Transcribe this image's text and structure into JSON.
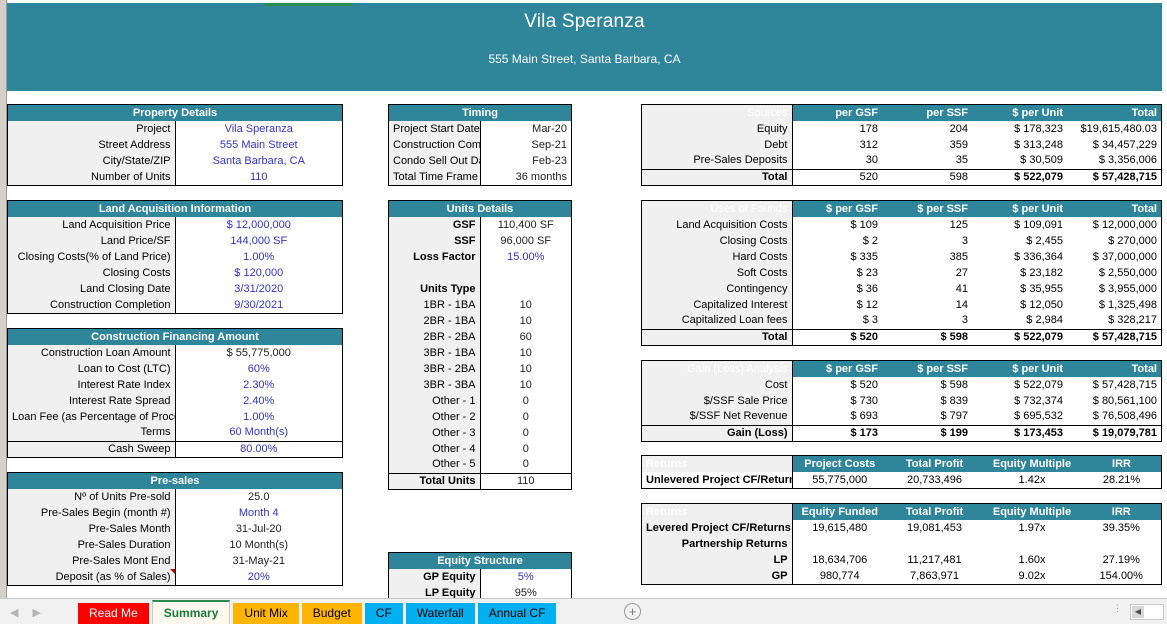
{
  "banner": {
    "title": "Vila Speranza",
    "subtitle": "555 Main Street, Santa Barbara, CA"
  },
  "property_details": {
    "header": "Property Details",
    "rows": [
      {
        "label": "Project",
        "value": "Vila Speranza",
        "style": "blue"
      },
      {
        "label": "Street Address",
        "value": "555 Main Street",
        "style": "blue"
      },
      {
        "label": "City/State/ZIP",
        "value": "Santa Barbara, CA",
        "style": "blue"
      },
      {
        "label": "Number of Units",
        "value": "110",
        "style": "blue"
      }
    ]
  },
  "land_acquisition": {
    "header": "Land Acquisition Information",
    "rows": [
      {
        "label": "Land Acquisition  Price",
        "value": "$ 12,000,000",
        "style": "blue"
      },
      {
        "label": "Land Price/SF",
        "value": "144,000 SF",
        "style": "blue"
      },
      {
        "label": "Closing Costs(% of Land Price)",
        "value": "1.00%",
        "style": "blue"
      },
      {
        "label": "Closing Costs",
        "value": "$ 120,000",
        "style": "blue"
      },
      {
        "label": "Land Closing Date",
        "value": "3/31/2020",
        "style": "blue"
      },
      {
        "label": "Construction Completion",
        "value": "9/30/2021",
        "style": "blue"
      }
    ]
  },
  "construction_financing": {
    "header": "Construction Financing Amount",
    "rows": [
      {
        "label": "Construction Loan Amount",
        "value": "$ 55,775,000",
        "style": "dark"
      },
      {
        "label": "Loan to Cost (LTC)",
        "value": "60%",
        "style": "blue"
      },
      {
        "label": "Interest Rate Index",
        "value": "2.30%",
        "style": "blue"
      },
      {
        "label": "Interest Rate Spread",
        "value": "2.40%",
        "style": "blue"
      },
      {
        "label": "Loan Fee (as Percentage of Proceeds)",
        "value": "1.00%",
        "style": "blue"
      },
      {
        "label": "Terms",
        "value": "60 Month(s)",
        "style": "blue"
      },
      {
        "label": "Cash Sweep",
        "value": "80.00%",
        "style": "blue",
        "divider": true
      }
    ]
  },
  "presales": {
    "header": "Pre-sales",
    "rows": [
      {
        "label": "Nº of Units Pre-sold",
        "value": "25.0",
        "style": "dark"
      },
      {
        "label": "Pre-Sales Begin (month #)",
        "value": "Month 4",
        "style": "blue"
      },
      {
        "label": "Pre-Sales Month",
        "value": "31-Jul-20",
        "style": "dark"
      },
      {
        "label": "Pre-Sales Duration",
        "value": "10 Month(s)",
        "style": "dark"
      },
      {
        "label": "Pre-Sales Mont End",
        "value": "31-May-21",
        "style": "dark"
      },
      {
        "label": "Deposit (as % of Sales)",
        "value": "20%",
        "style": "blue",
        "comment": true
      }
    ]
  },
  "timing": {
    "header": "Timing",
    "rows": [
      {
        "label": "Project Start Date",
        "value": "Mar-20"
      },
      {
        "label": "Construction Completion",
        "value": "Sep-21"
      },
      {
        "label": "Condo Sell Out Date",
        "value": "Feb-23"
      },
      {
        "label": "Total Time Frame",
        "value": "36 months"
      }
    ]
  },
  "units_details": {
    "header": "Units Details",
    "top_rows": [
      {
        "label": "GSF",
        "value": "110,400 SF",
        "style": "dark"
      },
      {
        "label": "SSF",
        "value": "96,000 SF",
        "style": "dark"
      },
      {
        "label": "Loss Factor",
        "value": "15.00%",
        "style": "blue"
      }
    ],
    "units_type_label": "Units Type",
    "unit_rows": [
      {
        "label": "1BR - 1BA",
        "value": "10"
      },
      {
        "label": "2BR - 1BA",
        "value": "10"
      },
      {
        "label": "2BR - 2BA",
        "value": "60"
      },
      {
        "label": "3BR - 1BA",
        "value": "10"
      },
      {
        "label": "3BR - 2BA",
        "value": "10"
      },
      {
        "label": "3BR - 3BA",
        "value": "10"
      },
      {
        "label": "Other - 1",
        "value": "0"
      },
      {
        "label": "Other - 2",
        "value": "0"
      },
      {
        "label": "Other - 3",
        "value": "0"
      },
      {
        "label": "Other - 4",
        "value": "0"
      },
      {
        "label": "Other - 5",
        "value": "0"
      }
    ],
    "total": {
      "label": "Total Units",
      "value": "110"
    }
  },
  "equity_structure": {
    "header": "Equity Structure",
    "rows": [
      {
        "label": "GP Equity",
        "value": "5%",
        "style": "blue"
      },
      {
        "label": "LP Equity",
        "value": "95%",
        "style": "dark"
      }
    ]
  },
  "sources": {
    "columns": [
      "Sources",
      "per GSF",
      "per SSF",
      "$ per Unit",
      "Total"
    ],
    "rows": [
      [
        "Equity",
        "178",
        "204",
        "$ 178,323",
        "$19,615,480.03"
      ],
      [
        "Debt",
        "312",
        "359",
        "$ 313,248",
        "$ 34,457,229"
      ],
      [
        "Pre-Sales Deposits",
        "30",
        "35",
        "$ 30,509",
        "$ 3,356,006"
      ]
    ],
    "total": [
      "Total",
      "520",
      "598",
      "$ 522,079",
      "$ 57,428,715"
    ]
  },
  "uses": {
    "columns": [
      "Uses of Founds",
      "$ per GSF",
      "$ per SSF",
      "$ per Unit",
      "Total"
    ],
    "rows": [
      [
        "Land Acquisition Costs",
        "$ 109",
        "125",
        "$ 109,091",
        "$ 12,000,000"
      ],
      [
        "Closing Costs",
        "$ 2",
        "3",
        "$ 2,455",
        "$ 270,000"
      ],
      [
        "Hard Costs",
        "$ 335",
        "385",
        "$ 336,364",
        "$ 37,000,000"
      ],
      [
        "Soft Costs",
        "$ 23",
        "27",
        "$ 23,182",
        "$ 2,550,000"
      ],
      [
        "Contingency",
        "$ 36",
        "41",
        "$ 35,955",
        "$ 3,955,000"
      ],
      [
        "Capitalized Interest",
        "$ 12",
        "14",
        "$ 12,050",
        "$ 1,325,498"
      ],
      [
        "Capitalized Loan fees",
        "$ 3",
        "3",
        "$ 2,984",
        "$ 328,217"
      ]
    ],
    "total": [
      "Total",
      "$ 520",
      "$ 598",
      "$ 522,079",
      "$ 57,428,715"
    ]
  },
  "gain_loss": {
    "columns": [
      "Gain (Loss) Analysis",
      "$ per GSF",
      "$ per SSF",
      "$ per Unit",
      "Total"
    ],
    "rows": [
      [
        "Cost",
        "$ 520",
        "$ 598",
        "$ 522,079",
        "$ 57,428,715"
      ],
      [
        "$/SSF Sale Price",
        "$ 730",
        "$ 839",
        "$ 732,374",
        "$ 80,561,100"
      ],
      [
        "$/SSF Net Revenue",
        "$ 693",
        "$ 797",
        "$ 695,532",
        "$ 76,508,496"
      ]
    ],
    "total": [
      "Gain (Loss)",
      "$ 173",
      "$ 199",
      "$ 173,453",
      "$ 19,079,781"
    ]
  },
  "returns_unlevered": {
    "columns": [
      "Returns",
      "Project Costs",
      "Total Profit",
      "Equity Multiple",
      "IRR"
    ],
    "rows": [
      [
        "Unlevered Project CF/Returns",
        "55,775,000",
        "20,733,496",
        "1.42x",
        "28.21%"
      ]
    ]
  },
  "returns_levered": {
    "columns": [
      "Returns",
      "Equity Funded",
      "Total Profit",
      "Equity Multiple",
      "IRR"
    ],
    "rows": [
      [
        "Levered Project CF/Returns",
        "19,615,480",
        "19,081,453",
        "1.97x",
        "39.35%"
      ],
      [
        "Partnership Returns",
        "",
        "",
        "",
        ""
      ],
      [
        "LP",
        "18,634,706",
        "11,217,481",
        "1.60x",
        "27.19%"
      ],
      [
        "GP",
        "980,774",
        "7,863,971",
        "9.02x",
        "154.00%"
      ]
    ]
  },
  "tabs": [
    {
      "label": "Read Me",
      "color": "#ff0000",
      "active": false
    },
    {
      "label": "Summary",
      "color": "#fdf9ef",
      "active": true
    },
    {
      "label": "Unit Mix",
      "color": "#ffb400",
      "active": false
    },
    {
      "label": "Budget",
      "color": "#ffb400",
      "active": false
    },
    {
      "label": "CF",
      "color": "#00b0f0",
      "active": false
    },
    {
      "label": "Waterfall",
      "color": "#00b0f0",
      "active": false
    },
    {
      "label": "Annual CF",
      "color": "#00b0f0",
      "active": false
    }
  ],
  "statusbar": {
    "add_sheet": "+",
    "prev_arrow": "◀",
    "next_arrow": "▶",
    "scroll_left": "◀"
  }
}
